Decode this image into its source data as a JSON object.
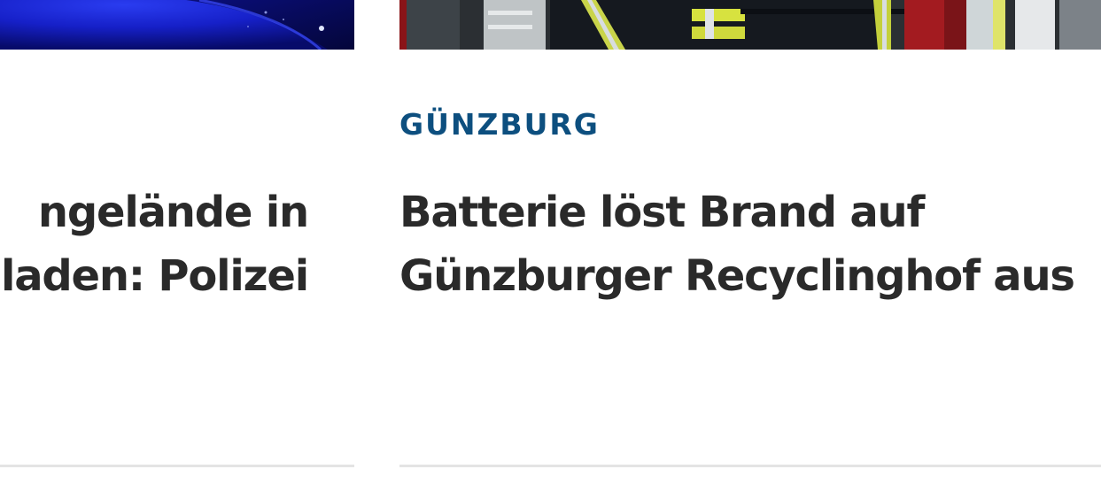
{
  "colors": {
    "kicker": "#0d4f7f",
    "headline": "#2a2a2a",
    "divider": "#e4e4e4"
  },
  "cards": [
    {
      "kicker": "",
      "headline_lines": [
        "ngelände in",
        "eladen: Polizei"
      ],
      "image_icon": "police-light-image"
    },
    {
      "kicker": "GÜNZBURG",
      "headline_lines": [
        "Batterie löst Brand auf",
        "Günzburger Recyclinghof aus"
      ],
      "image_icon": "firefighter-image"
    }
  ]
}
